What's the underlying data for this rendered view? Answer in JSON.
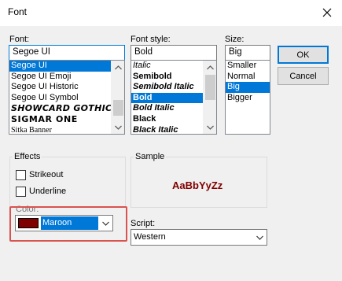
{
  "window": {
    "title": "Font"
  },
  "font": {
    "label": "Font:",
    "value": "Segoe UI",
    "items": [
      "Segoe UI",
      "Segoe UI Emoji",
      "Segoe UI Historic",
      "Segoe UI Symbol",
      "SHOWCARD GOTHIC",
      "SIGMAR ONE",
      "Sitka Banner"
    ],
    "selected_index": 0
  },
  "style": {
    "label": "Font style:",
    "value": "Bold",
    "items": [
      "Italic",
      "Semibold",
      "Semibold Italic",
      "Bold",
      "Bold Italic",
      "Black",
      "Black Italic"
    ],
    "selected_index": 3
  },
  "size": {
    "label": "Size:",
    "value": "Big",
    "items": [
      "Smaller",
      "Normal",
      "Big",
      "Bigger"
    ],
    "selected_index": 2
  },
  "buttons": {
    "ok": "OK",
    "cancel": "Cancel"
  },
  "effects": {
    "label": "Effects",
    "strikeout": "Strikeout",
    "strikeout_checked": false,
    "underline": "Underline",
    "underline_checked": false,
    "color_label": "Color:",
    "color_value": "Maroon",
    "color_hex": "#800000"
  },
  "sample": {
    "label": "Sample",
    "text": "AaBbYyZz"
  },
  "script": {
    "label": "Script:",
    "value": "Western"
  },
  "colors": {
    "accent": "#0078d7",
    "highlight": "#d9534f"
  },
  "icons": {
    "close": "close-icon",
    "scroll_up": "chevron-up-icon",
    "scroll_down": "chevron-down-icon",
    "dropdown": "chevron-down-icon"
  }
}
